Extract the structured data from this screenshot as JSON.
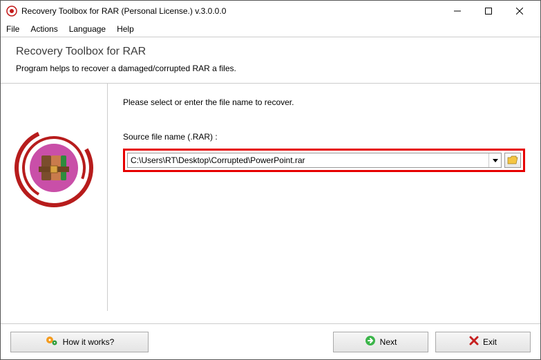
{
  "window": {
    "title": "Recovery Toolbox for RAR (Personal License.) v.3.0.0.0"
  },
  "menu": {
    "file": "File",
    "actions": "Actions",
    "language": "Language",
    "help": "Help"
  },
  "header": {
    "title": "Recovery Toolbox for RAR",
    "subtitle": "Program helps to recover a damaged/corrupted RAR a files."
  },
  "main": {
    "prompt": "Please select or enter the file name to recover.",
    "field_label": "Source file name (.RAR) :",
    "file_value": "C:\\Users\\RT\\Desktop\\Corrupted\\PowerPoint.rar"
  },
  "footer": {
    "how": "How it works?",
    "next": "Next",
    "exit": "Exit"
  }
}
